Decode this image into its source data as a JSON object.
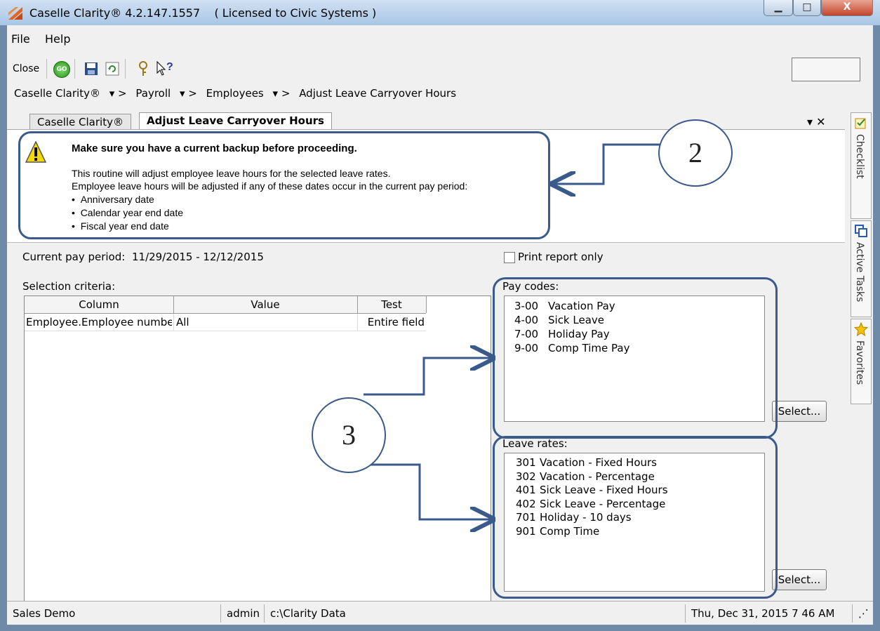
{
  "window": {
    "title": "Caselle Clarity® 4.2.147.1557    ( Licensed to Civic Systems )",
    "controls": {
      "minimize": "▁",
      "maximize": "□",
      "close": "X"
    }
  },
  "menu": {
    "file": "File",
    "help": "Help"
  },
  "toolbar": {
    "close_label": "Close",
    "go_label": "GO"
  },
  "breadcrumb": {
    "items": [
      "Caselle Clarity®",
      "Payroll",
      "Employees"
    ],
    "separator": "▾  >",
    "current": "Adjust Leave Carryover Hours"
  },
  "tabs": {
    "inactive": "Caselle Clarity®",
    "active": "Adjust Leave Carryover Hours",
    "controls": "▾ ✕"
  },
  "warning": {
    "heading": "Make sure you have a current backup before proceeding.",
    "line1": "This routine will adjust employee leave hours for the selected leave rates.",
    "line2": "Employee leave hours will be adjusted if any of these dates occur in the current pay period:",
    "bullets": [
      "Anniversary date",
      "Calendar year end date",
      "Fiscal year end date"
    ]
  },
  "annotations": {
    "callout2": "2",
    "callout3": "3"
  },
  "form": {
    "pay_period_label": "Current pay period:",
    "pay_period_value": "11/29/2015 - 12/12/2015",
    "print_report_only": "Print report only",
    "selection_label": "Selection criteria:",
    "columns": [
      "Column",
      "Value",
      "Test"
    ],
    "rows": [
      {
        "column": "Employee.Employee number",
        "value": "All",
        "test": "Entire field"
      }
    ]
  },
  "pay_codes": {
    "label": "Pay codes:",
    "items": [
      {
        "code": "3-00",
        "name": "Vacation Pay"
      },
      {
        "code": "4-00",
        "name": "Sick Leave"
      },
      {
        "code": "7-00",
        "name": "Holiday Pay"
      },
      {
        "code": "9-00",
        "name": "Comp Time Pay"
      }
    ],
    "select_button": "Select..."
  },
  "leave_rates": {
    "label": "Leave rates:",
    "items": [
      {
        "code": "301",
        "name": "Vacation - Fixed Hours"
      },
      {
        "code": "302",
        "name": "Vacation - Percentage"
      },
      {
        "code": "401",
        "name": "Sick Leave - Fixed Hours"
      },
      {
        "code": "402",
        "name": "Sick Leave - Percentage"
      },
      {
        "code": "701",
        "name": "Holiday - 10 days"
      },
      {
        "code": "901",
        "name": "Comp Time"
      }
    ],
    "select_button": "Select..."
  },
  "side_tabs": [
    "Checklist",
    "Active Tasks",
    "Favorites"
  ],
  "status": {
    "company": "Sales Demo",
    "user": "admin",
    "path": "c:\\Clarity Data",
    "datetime": "Thu, Dec 31, 2015 7 46 AM"
  },
  "colors": {
    "annotation": "#3a5a8c",
    "warning_yellow": "#f5d800"
  }
}
